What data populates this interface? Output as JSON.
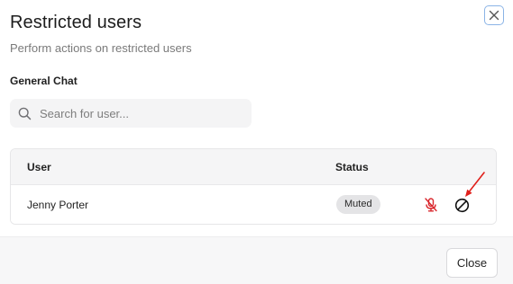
{
  "dialog": {
    "title": "Restricted users",
    "subtitle": "Perform actions on restricted users",
    "close_icon": "close-icon"
  },
  "channel": {
    "label": "General Chat"
  },
  "search": {
    "placeholder": "Search for user...",
    "value": "",
    "icon": "search-icon"
  },
  "table": {
    "columns": [
      "User",
      "Status"
    ],
    "rows": [
      {
        "user": "Jenny Porter",
        "status": "Muted",
        "actions": [
          "unmute-icon",
          "ban-icon"
        ]
      }
    ]
  },
  "footer": {
    "close_label": "Close"
  },
  "colors": {
    "accent_border": "#8bb4e6",
    "unmute_icon": "#d9262c",
    "annotation_arrow": "#e0201b",
    "badge_bg": "#e4e4e6"
  }
}
